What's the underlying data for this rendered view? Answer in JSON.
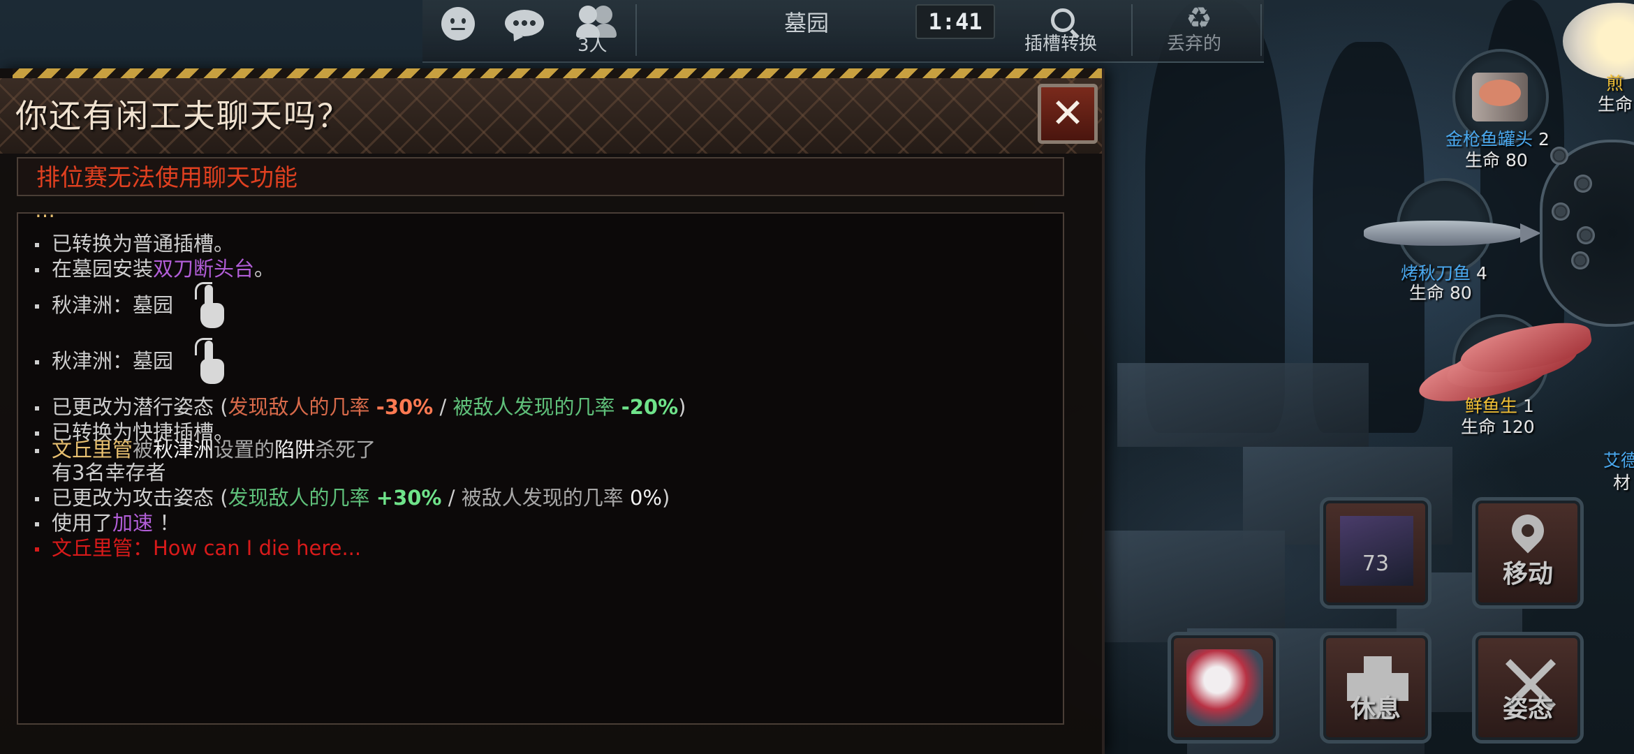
{
  "topbar": {
    "location": "墓园",
    "timer": "1:41",
    "players": "3人",
    "slot_switch": "插槽转换",
    "discard": "丢弃的"
  },
  "dialog": {
    "title": "你还有闲工夫聊天吗？",
    "close": "✕",
    "notice": "排位赛无法使用聊天功能",
    "log": {
      "l1": "已转换为普通插槽。",
      "l2a": "在墓园安装",
      "l2b": "双刀断头台",
      "l2c": "。",
      "l3": "秋津洲：墓园",
      "l4": "秋津洲：墓园",
      "l5a": "已更改为潜行姿态 (",
      "l5b": "发现敌人的几率",
      "l5c": "-30%",
      "l5d": " / ",
      "l5e": "被敌人发现的几率",
      "l5f": "-20%",
      "l5g": ")",
      "l6": "已转换为快捷插槽。",
      "l7a": "文丘里管",
      "l7b": "被",
      "l7c": "秋津洲",
      "l7d": "设置的",
      "l7e": "陷阱",
      "l7f": "杀死了",
      "l7g": "有3名幸存者",
      "l8a": "已更改为攻击姿态 (",
      "l8b": "发现敌人的几率",
      "l8c": "+30%",
      "l8d": " / ",
      "l8e": "被敌人发现的几率",
      "l8f": "0%",
      "l8g": ")",
      "l9a": "使用了",
      "l9b": "加速",
      "l9c": "！",
      "l10": "文丘里管：How can I die here..."
    }
  },
  "items": {
    "tuna": {
      "name": "金枪鱼罐头",
      "count": "2",
      "hp": "生命 80"
    },
    "saury": {
      "name": "烤秋刀鱼",
      "count": "4",
      "hp": "生命 80"
    },
    "sashimi": {
      "name": "鲜鱼生",
      "count": "1",
      "hp": "生命 120"
    },
    "top_right": {
      "name": "煎",
      "hp": "生命"
    },
    "edge": {
      "name": "艾德",
      "sub": "材"
    }
  },
  "actions": {
    "bandage_count": "73",
    "move": "移动",
    "rest": "休息",
    "stance": "姿态"
  },
  "colors": {
    "accent_red": "#e04020",
    "purple": "#b25ed8",
    "green": "#6fe38a",
    "gold": "#e8c070"
  }
}
